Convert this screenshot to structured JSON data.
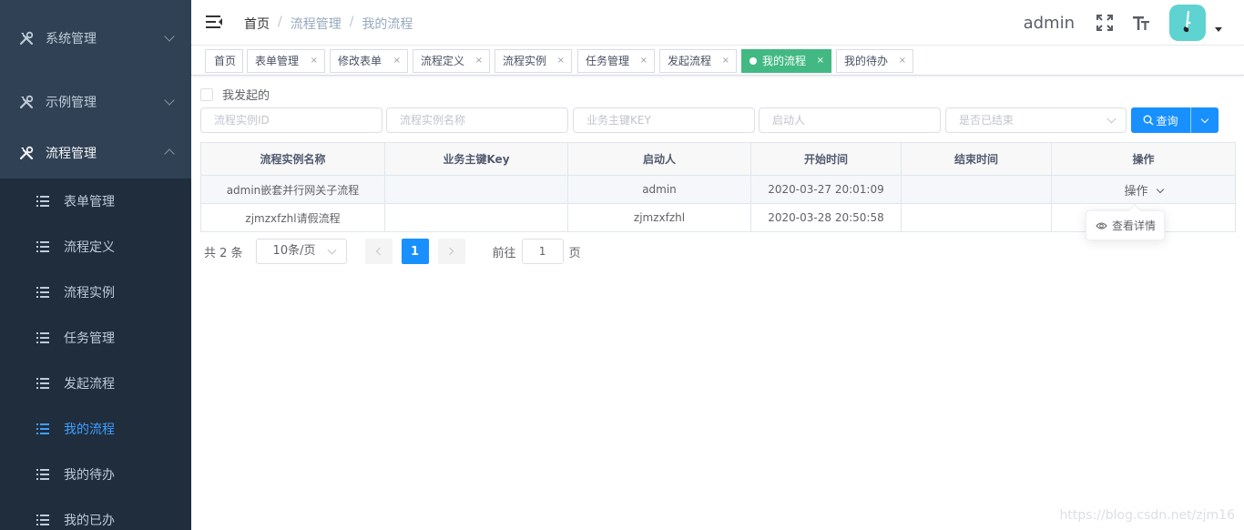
{
  "sidebar": {
    "menus": [
      {
        "label": "系统管理",
        "icon": "tools-icon",
        "open": false
      },
      {
        "label": "示例管理",
        "icon": "tools-icon",
        "open": false
      },
      {
        "label": "流程管理",
        "icon": "tools-icon",
        "open": true
      }
    ],
    "submenu": [
      {
        "label": "表单管理",
        "active": false
      },
      {
        "label": "流程定义",
        "active": false
      },
      {
        "label": "流程实例",
        "active": false
      },
      {
        "label": "任务管理",
        "active": false
      },
      {
        "label": "发起流程",
        "active": false
      },
      {
        "label": "我的流程",
        "active": true
      },
      {
        "label": "我的待办",
        "active": false
      },
      {
        "label": "我的已办",
        "active": false
      }
    ]
  },
  "navbar": {
    "breadcrumb": [
      "首页",
      "流程管理",
      "我的流程"
    ],
    "breadcrumb_sep": "/",
    "username": "admin",
    "icons": [
      "fullscreen-icon",
      "font-size-icon"
    ]
  },
  "tags": [
    {
      "label": "首页",
      "closable": false
    },
    {
      "label": "表单管理",
      "closable": true
    },
    {
      "label": "修改表单",
      "closable": true
    },
    {
      "label": "流程定义",
      "closable": true
    },
    {
      "label": "流程实例",
      "closable": true
    },
    {
      "label": "任务管理",
      "closable": true
    },
    {
      "label": "发起流程",
      "closable": true
    },
    {
      "label": "我的流程",
      "closable": true,
      "active": true
    },
    {
      "label": "我的待办",
      "closable": true
    }
  ],
  "tag_close": "×",
  "filters": {
    "my_started_label": "我发起的",
    "instance_id_placeholder": "流程实例ID",
    "instance_name_placeholder": "流程实例名称",
    "business_key_placeholder": "业务主键KEY",
    "starter_placeholder": "启动人",
    "finished_placeholder": "是否已结束",
    "query_label": "查询"
  },
  "table": {
    "columns": [
      "流程实例名称",
      "业务主键Key",
      "启动人",
      "开始时间",
      "结束时间",
      "操作"
    ],
    "rows": [
      {
        "name": "admin嵌套并行网关子流程",
        "key": "",
        "starter": "admin",
        "start": "2020-03-27 20:01:09",
        "end": "",
        "op": "操作"
      },
      {
        "name": "zjmzxfzhl请假流程",
        "key": "",
        "starter": "zjmzxfzhl",
        "start": "2020-03-28 20:50:58",
        "end": "",
        "op": ""
      }
    ]
  },
  "dropdown": {
    "item": "查看详情",
    "icon": "eye-icon"
  },
  "pagination": {
    "total": "共 2 条",
    "page_size": "10条/页",
    "current_page": "1",
    "goto_prefix": "前往",
    "goto_value": "1",
    "goto_suffix": "页"
  },
  "watermark": "https://blog.csdn.net/zjm16",
  "colors": {
    "sidebar": "#304156",
    "submenu": "#1f2d3d",
    "active_menu": "#409eff",
    "active_tag": "#42b983",
    "primary": "#1890ff"
  }
}
